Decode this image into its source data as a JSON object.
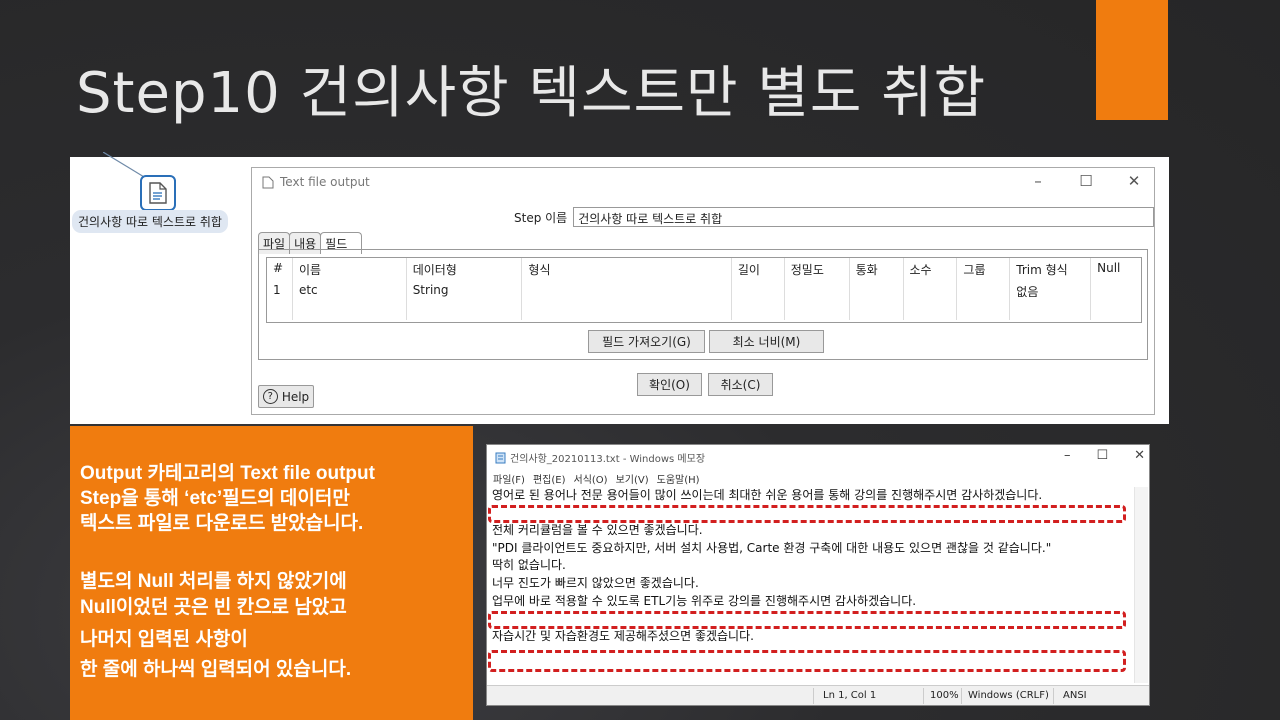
{
  "slide": {
    "title": "Step10 건의사항 텍스트만 별도 취합",
    "colors": {
      "accent": "#f07c0f",
      "background": "#2b2b2d",
      "highlight": "#d21f1f"
    }
  },
  "canvas": {
    "step_label": "건의사항 따로 텍스트로 취합",
    "step_icon": "text-file-output-icon"
  },
  "dialog": {
    "title": "Text file output",
    "window_buttons": [
      "–",
      "☐",
      "✕"
    ],
    "step_name_label": "Step 이름",
    "step_name_value": "건의사항 따로 텍스트로 취합",
    "tabs": [
      "파일",
      "내용",
      "필드"
    ],
    "active_tab": "필드",
    "columns": [
      "#",
      "이름",
      "데이터형",
      "형식",
      "길이",
      "정밀도",
      "통화",
      "소수",
      "그룹",
      "Trim 형식",
      "Null"
    ],
    "rows": [
      [
        "1",
        "etc",
        "String",
        "",
        "",
        "",
        "",
        "",
        "",
        "없음",
        ""
      ]
    ],
    "get_fields_button": "필드 가져오기(G)",
    "min_width_button": "최소 너비(M)",
    "ok_button": "확인(O)",
    "cancel_button": "취소(C)",
    "help_button": "Help"
  },
  "info": {
    "paragraph1": [
      "Output 카테고리의 Text file output",
      "Step을 통해 ‘etc’필드의 데이터만",
      "텍스트 파일로 다운로드 받았습니다."
    ],
    "paragraph2": [
      "별도의 Null 처리를 하지 않았기에",
      "Null이었던 곳은 빈 칸으로 남았고",
      "나머지 입력된 사항이",
      "한 줄에 하나씩 입력되어 있습니다."
    ]
  },
  "notepad": {
    "title": "건의사항_20210113.txt - Windows 메모장",
    "menu": [
      "파일(F)",
      "편집(E)",
      "서식(O)",
      "보기(V)",
      "도움말(H)"
    ],
    "lines": [
      "영어로 된 용어나 전문 용어들이 많이 쓰이는데 최대한 쉬운 용어를 통해 강의를 진행해주시면 감사하겠습니다.",
      "",
      "전체 커리큘럼을 볼 수 있으면 좋겠습니다.",
      "\"PDI 클라이언트도 중요하지만, 서버 설치 사용법, Carte 환경 구축에 대한 내용도 있으면 괜찮을 것 같습니다.\"",
      "딱히 없습니다.",
      "너무 진도가 빠르지 않았으면 좋겠습니다.",
      "업무에 바로 적용할 수 있도록 ETL기능 위주로 강의를 진행해주시면 감사하겠습니다.",
      "",
      "자습시간 및 자습환경도 제공해주셨으면 좋겠습니다.",
      "",
      ""
    ],
    "status": {
      "position": "Ln 1, Col 1",
      "zoom": "100%",
      "line_ending": "Windows (CRLF)",
      "encoding": "ANSI"
    }
  }
}
